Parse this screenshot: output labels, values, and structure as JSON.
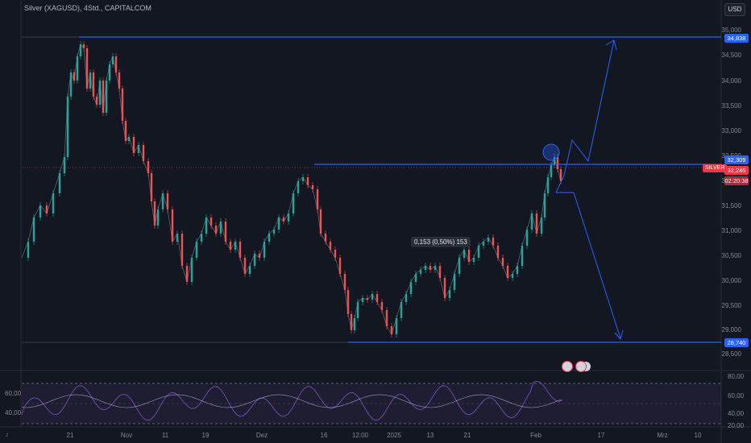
{
  "header": {
    "title": "Silver (XAGUSD), 4Std., CAPITALCOM",
    "currency": "USD"
  },
  "price_axis": {
    "ticks": [
      "35,000",
      "34,500",
      "34,000",
      "33,500",
      "33,000",
      "32,500",
      "32,000",
      "31,500",
      "31,000",
      "30,500",
      "30,000",
      "29,500",
      "29,000",
      "28,500"
    ],
    "tags": {
      "resistance_top": "34,838",
      "resistance_mid": "32,309",
      "current": "32,245",
      "support": "28,740",
      "symbol": "SILVER",
      "countdown": "02:20:38"
    }
  },
  "time_axis": {
    "ticks": [
      "21",
      "Nov",
      "11",
      "19",
      "Dez",
      "16",
      "12:00",
      "2025",
      "13",
      "21",
      "Feb",
      "17",
      "Mrz",
      "10"
    ]
  },
  "measurement": {
    "label": "0,153 (0,50%) 153"
  },
  "rsi": {
    "ticks_left": [
      "60,00",
      "40,00"
    ],
    "ticks_right": [
      "80,00",
      "60,00",
      "40,00",
      "20,00"
    ]
  },
  "colors": {
    "bg": "#131722",
    "up": "#26a69a",
    "down": "#ef5350",
    "drawing": "#2962ff",
    "rsi": "#7e57c2"
  },
  "icons": {
    "events": [
      "us-flag-icon",
      "us-flag-icon"
    ]
  },
  "footer": {
    "z_label": "z"
  }
}
